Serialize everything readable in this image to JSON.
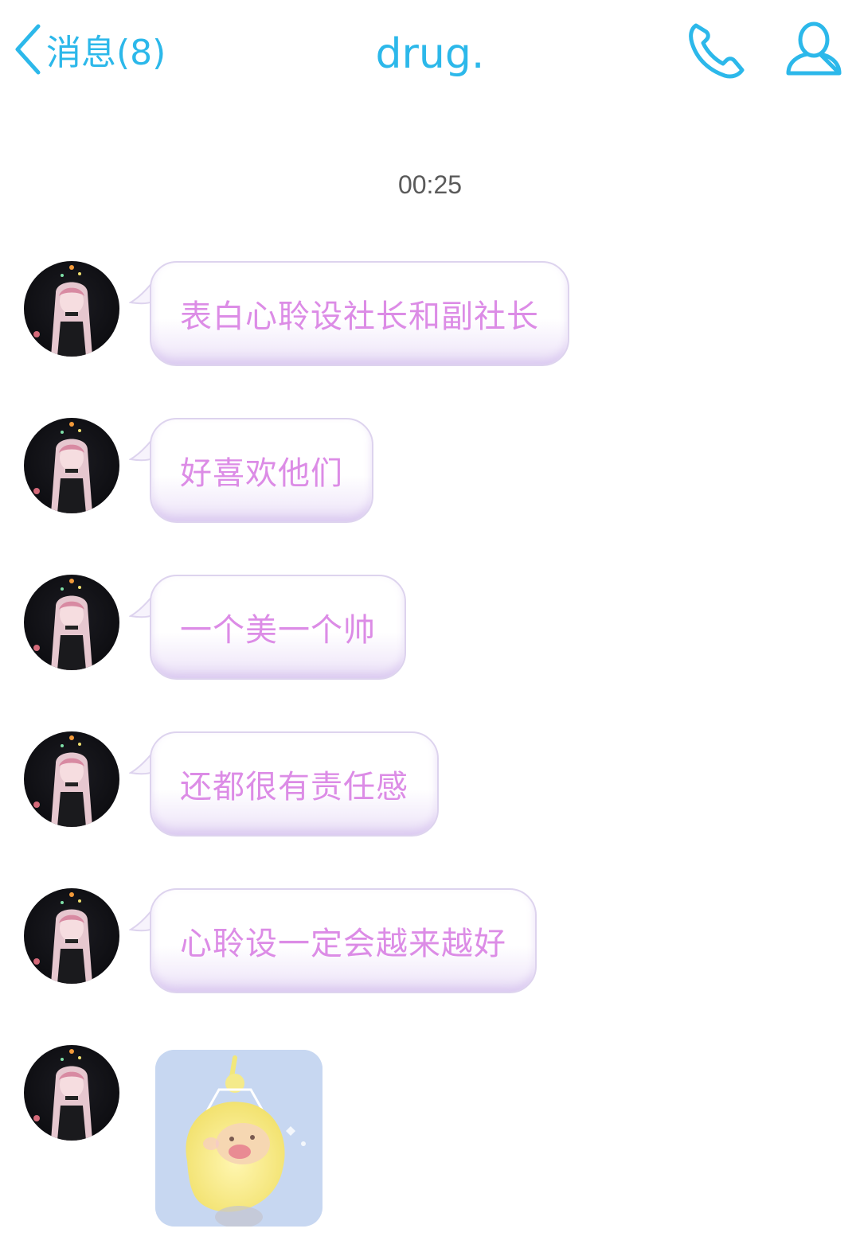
{
  "nav": {
    "back_label": "消息(8)",
    "title": "drug.",
    "accent_color": "#2cb8ea"
  },
  "timestamp": "00:25",
  "messages": [
    {
      "type": "text",
      "text": "表白心聆设社长和副社长"
    },
    {
      "type": "text",
      "text": "好喜欢他们"
    },
    {
      "type": "text",
      "text": "一个美一个帅"
    },
    {
      "type": "text",
      "text": "还都很有责任感"
    },
    {
      "type": "text",
      "text": "心聆设一定会越来越好"
    },
    {
      "type": "sticker",
      "icon": "yellow-teletubby-sticker"
    }
  ],
  "colors": {
    "bubble_text": "#dc8ce6",
    "bubble_border": "#ddd3ee",
    "timestamp": "#5a5a5a"
  },
  "icons": {
    "back": "chevron-left-icon",
    "call": "phone-icon",
    "profile": "person-icon"
  }
}
